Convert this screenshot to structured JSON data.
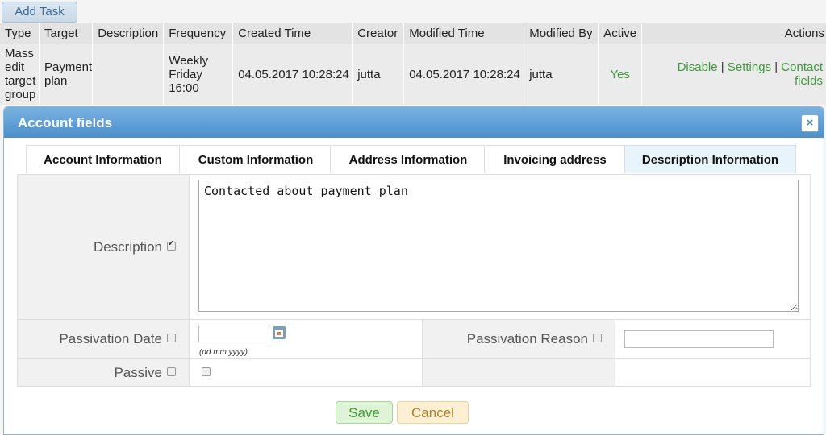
{
  "toolbar": {
    "add_task_label": "Add Task"
  },
  "task_table": {
    "columns": [
      "Type",
      "Target",
      "Description",
      "Frequency",
      "Created Time",
      "Creator",
      "Modified Time",
      "Modified By",
      "Active",
      "Actions"
    ],
    "row": {
      "type": "Mass edit target group",
      "target": "Payment plan",
      "description": "",
      "frequency": "Weekly Friday 16:00",
      "created_time": "04.05.2017 10:28:24",
      "creator": "jutta",
      "modified_time": "04.05.2017 10:28:24",
      "modified_by": "jutta",
      "active": "Yes",
      "actions": [
        "Disable",
        "Settings",
        "Contact fields"
      ]
    }
  },
  "dialog": {
    "title": "Account fields",
    "close_symbol": "×",
    "tabs": [
      "Account Information",
      "Custom Information",
      "Address Information",
      "Invoicing address",
      "Description Information"
    ],
    "active_tab": "Description Information",
    "fields": {
      "description_label": "Description",
      "description_value": "Contacted about payment plan",
      "passivation_date_label": "Passivation Date",
      "passivation_date_value": "",
      "date_hint": "(dd.mm.yyyy)",
      "passivation_reason_label": "Passivation Reason",
      "passivation_reason_value": "",
      "passive_label": "Passive"
    },
    "buttons": {
      "save": "Save",
      "cancel": "Cancel"
    }
  },
  "colors": {
    "accent": "#4a8fcd",
    "link_green": "#3c9a3c",
    "save_bg": "#dff3d6",
    "cancel_bg": "#fbf0d2"
  }
}
